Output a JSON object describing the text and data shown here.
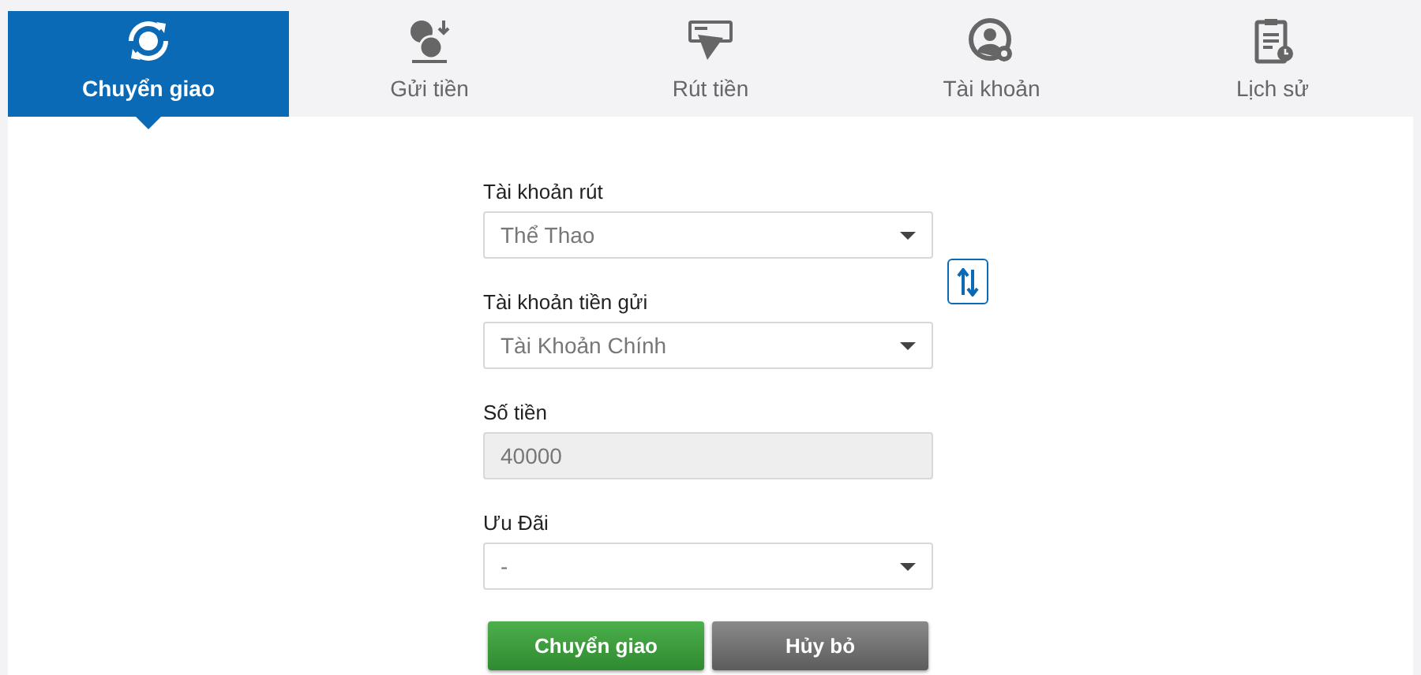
{
  "tabs": [
    {
      "label": "Chuyển giao",
      "kind": "transfer",
      "selected": true
    },
    {
      "label": "Gửi tiền",
      "kind": "deposit",
      "selected": false
    },
    {
      "label": "Rút tiền",
      "kind": "withdraw",
      "selected": false
    },
    {
      "label": "Tài khoản",
      "kind": "account",
      "selected": false
    },
    {
      "label": "Lịch sử",
      "kind": "history",
      "selected": false
    }
  ],
  "form": {
    "fields": [
      {
        "label": "Tài khoản rút",
        "kind": "select",
        "value": "Thể Thao",
        "disabled": false
      },
      {
        "label": "Tài khoản tiền gửi",
        "kind": "select",
        "value": "Tài Khoản Chính",
        "disabled": false
      },
      {
        "label": "Số tiền",
        "kind": "input",
        "value": "40000",
        "disabled": true
      },
      {
        "label": "Ưu Đãi",
        "kind": "select",
        "value": "-",
        "disabled": false
      }
    ],
    "buttons": [
      {
        "label": "Chuyển giao",
        "kind": "primary"
      },
      {
        "label": "Hủy bỏ",
        "kind": "secondary"
      }
    ]
  }
}
